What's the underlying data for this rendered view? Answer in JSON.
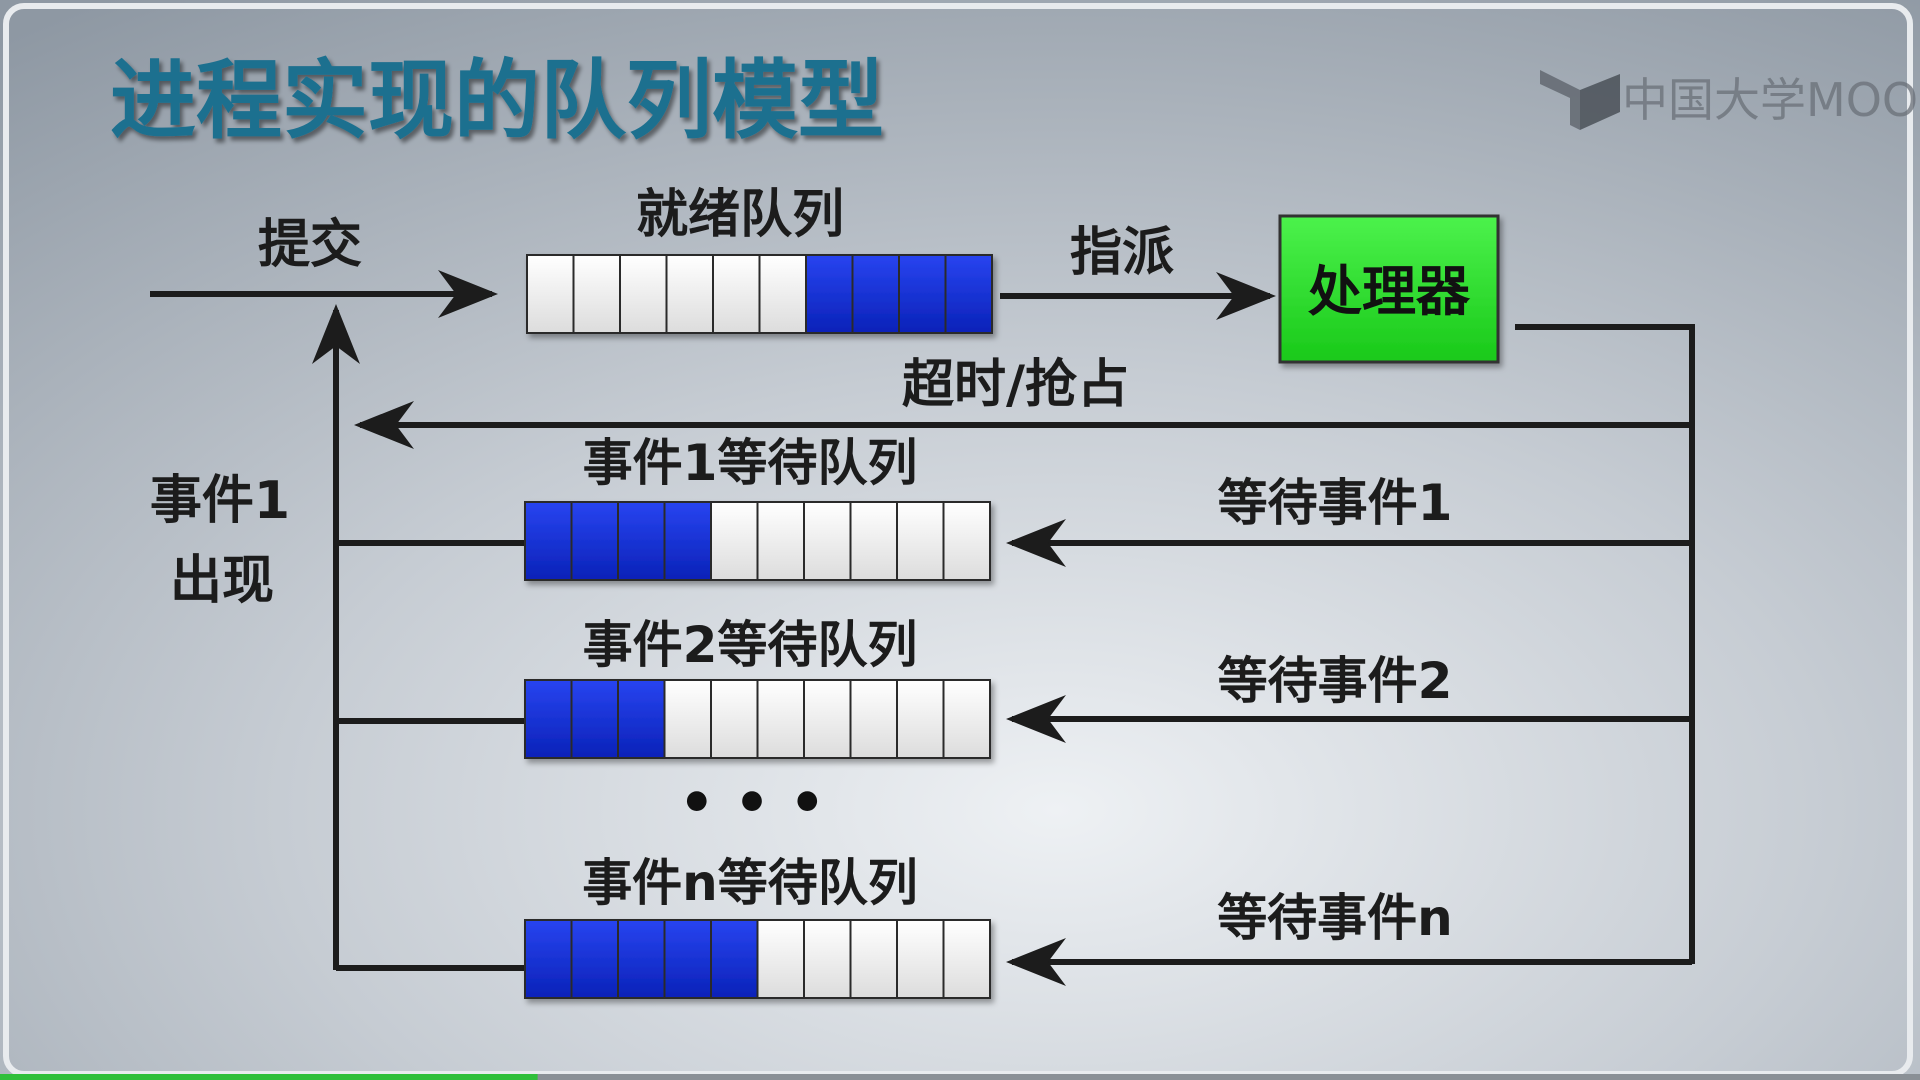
{
  "slide": {
    "title": "进程实现的队列模型",
    "logo_text": "中国大学MOOC",
    "colors": {
      "title": "#1f6f8f",
      "queue_filled": "#1430d8",
      "queue_empty": "#f1f1f1",
      "processor": "#2ee62e",
      "line": "#1c1c1c"
    }
  },
  "diagram": {
    "submit_label": "提交",
    "ready_queue_label": "就绪队列",
    "dispatch_label": "指派",
    "processor_label": "处理器",
    "timeout_label": "超时/抢占",
    "event_occurs_label_line1": "事件1",
    "event_occurs_label_line2": "出现",
    "ellipsis": "• • •",
    "ready_queue": {
      "filled": 4,
      "empty": 6,
      "filled_side": "right"
    },
    "wait_queues": [
      {
        "label": "事件1等待队列",
        "wait_label": "等待事件1",
        "filled": 4,
        "empty": 6
      },
      {
        "label": "事件2等待队列",
        "wait_label": "等待事件2",
        "filled": 3,
        "empty": 7
      },
      {
        "label": "事件n等待队列",
        "wait_label": "等待事件n",
        "filled": 5,
        "empty": 5
      }
    ]
  },
  "footer": {
    "progress": 0.28
  }
}
